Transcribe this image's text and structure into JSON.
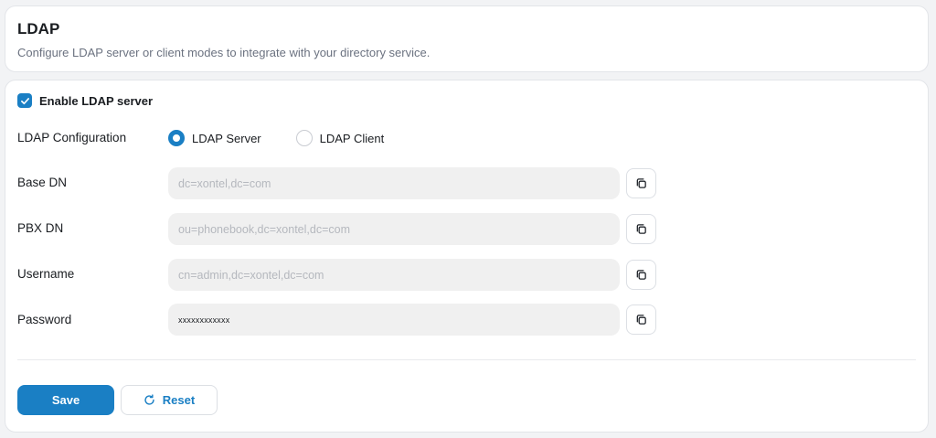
{
  "header": {
    "title": "LDAP",
    "description": "Configure LDAP server or client modes to integrate with your directory service."
  },
  "enable": {
    "label": "Enable LDAP server",
    "checked": true
  },
  "configuration": {
    "label": "LDAP Configuration",
    "options": [
      {
        "label": "LDAP Server",
        "selected": true
      },
      {
        "label": "LDAP Client",
        "selected": false
      }
    ]
  },
  "fields": {
    "base_dn": {
      "label": "Base DN",
      "placeholder": "dc=xontel,dc=com",
      "value": ""
    },
    "pbx_dn": {
      "label": "PBX DN",
      "placeholder": "ou=phonebook,dc=xontel,dc=com",
      "value": ""
    },
    "username": {
      "label": "Username",
      "placeholder": "cn=admin,dc=xontel,dc=com",
      "value": ""
    },
    "password": {
      "label": "Password",
      "placeholder": "",
      "value": "xxxxxxxxxxxx"
    }
  },
  "icons": {
    "copy": "copy-icon",
    "reset": "refresh-icon",
    "check": "check-icon"
  },
  "actions": {
    "save_label": "Save",
    "reset_label": "Reset"
  },
  "colors": {
    "accent": "#1a7fc4",
    "input_bg": "#f0f0f0",
    "page_bg": "#f2f3f5"
  }
}
